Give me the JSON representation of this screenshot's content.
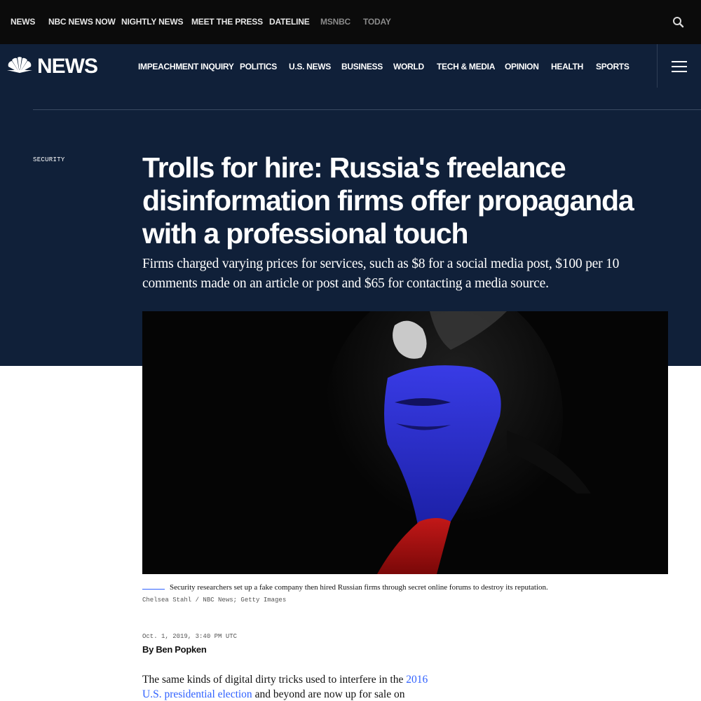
{
  "topbar": {
    "links": [
      "NEWS",
      "NBC NEWS NOW",
      "NIGHTLY NEWS",
      "MEET THE PRESS",
      "DATELINE",
      "MSNBC",
      "TODAY"
    ],
    "icons": {
      "search": "search-icon"
    }
  },
  "header": {
    "logo_text": "NEWS",
    "sections": [
      "IMPEACHMENT INQUIRY",
      "POLITICS",
      "U.S. NEWS",
      "BUSINESS",
      "WORLD",
      "TECH & MEDIA",
      "OPINION",
      "HEALTH",
      "SPORTS"
    ],
    "icons": {
      "logo": "nbc-peacock-icon",
      "menu": "hamburger-menu-icon"
    }
  },
  "article": {
    "label": "SECURITY",
    "headline": "Trolls for hire: Russia's freelance disinformation firms offer propaganda with a professional touch",
    "dek": "Firms charged varying prices for services, such as $8 for a social media post, $100 per 10 comments made on an article or post and $65 for contacting a media source.",
    "caption": "Security researchers set up a fake company then hired Russian firms through secret online forums to destroy its reputation.",
    "credit": "Chelsea Stahl / NBC News; Getty Images",
    "timestamp": "Oct. 1, 2019, 3:40 PM UTC",
    "byline": "By Ben Popken",
    "body_start": "The same kinds of digital dirty tricks used to interfere in the ",
    "body_link": "2016 U.S. presidential election",
    "body_end": " and beyond are now up for sale on"
  },
  "colors": {
    "topbar_bg": "#0b0b0b",
    "brand_navy": "#102039",
    "link_blue": "#3061ff"
  }
}
